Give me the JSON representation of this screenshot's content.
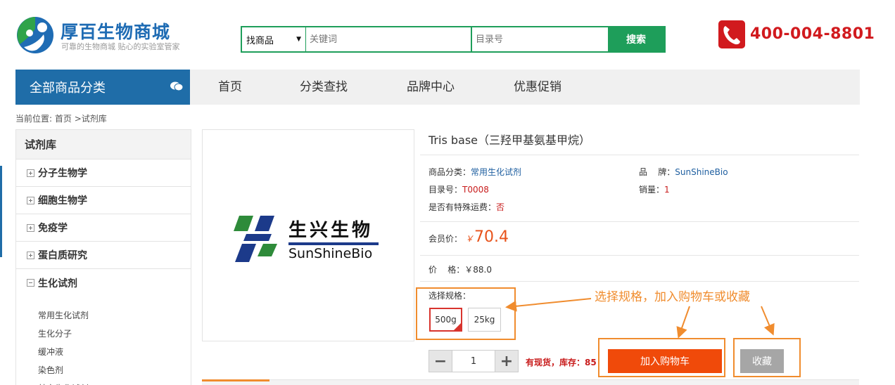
{
  "header": {
    "brand_name": "厚百生物商城",
    "slogan": "可靠的生物商城 贴心的实验室管家",
    "phone": "400-004-8801"
  },
  "search": {
    "scope": "找商品",
    "keyword_placeholder": "关键词",
    "catalog_placeholder": "目录号",
    "button": "搜索"
  },
  "nav": {
    "all_categories": "全部商品分类",
    "items": [
      "首页",
      "分类查找",
      "品牌中心",
      "优惠促销"
    ]
  },
  "breadcrumb": {
    "prefix": "当前位置:",
    "home": "首页",
    "sep": ">",
    "current": "试剂库"
  },
  "sidebar": {
    "title": "试剂库",
    "categories": [
      "分子生物学",
      "细胞生物学",
      "免疫学",
      "蛋白质研究",
      "生化试剂"
    ],
    "subitems": [
      "常用生化试剂",
      "生化分子",
      "缓冲液",
      "染色剂",
      "其它生化试剂"
    ]
  },
  "brand_logo": {
    "cn": "生兴生物",
    "en": "SunShineBio"
  },
  "product": {
    "title": "Tris base（三羟甲基氨基甲烷）",
    "category_label": "商品分类：",
    "category": "常用生化试剂",
    "brand_label": "品    牌：",
    "brand": "SunShineBio",
    "catalog_label": "目录号：",
    "catalog": "T0008",
    "sales_label": "销量：",
    "sales": "1",
    "special_label": "是否有特殊运费：",
    "special": "否",
    "member_label": "会员价：",
    "member_yen": "￥",
    "member_price": "70.4",
    "list_price_label": "价    格：",
    "list_price": "￥88.0",
    "spec_label": "选择规格：",
    "specs": [
      "500g",
      "25kg"
    ],
    "quantity": "1",
    "minus": "−",
    "plus": "+",
    "stock": "有现货，库存：85",
    "add_to_cart": "加入购物车",
    "favorite": "收藏"
  },
  "annotation": {
    "text": "选择规格，加入购物车或收藏"
  },
  "colors": {
    "brand_blue": "#1f6da8",
    "search_green": "#1e9e5a",
    "price_orange": "#e8531b",
    "cart_orange": "#f04a0a",
    "annotation_orange": "#f08c2e",
    "phone_red": "#d11a1e"
  }
}
